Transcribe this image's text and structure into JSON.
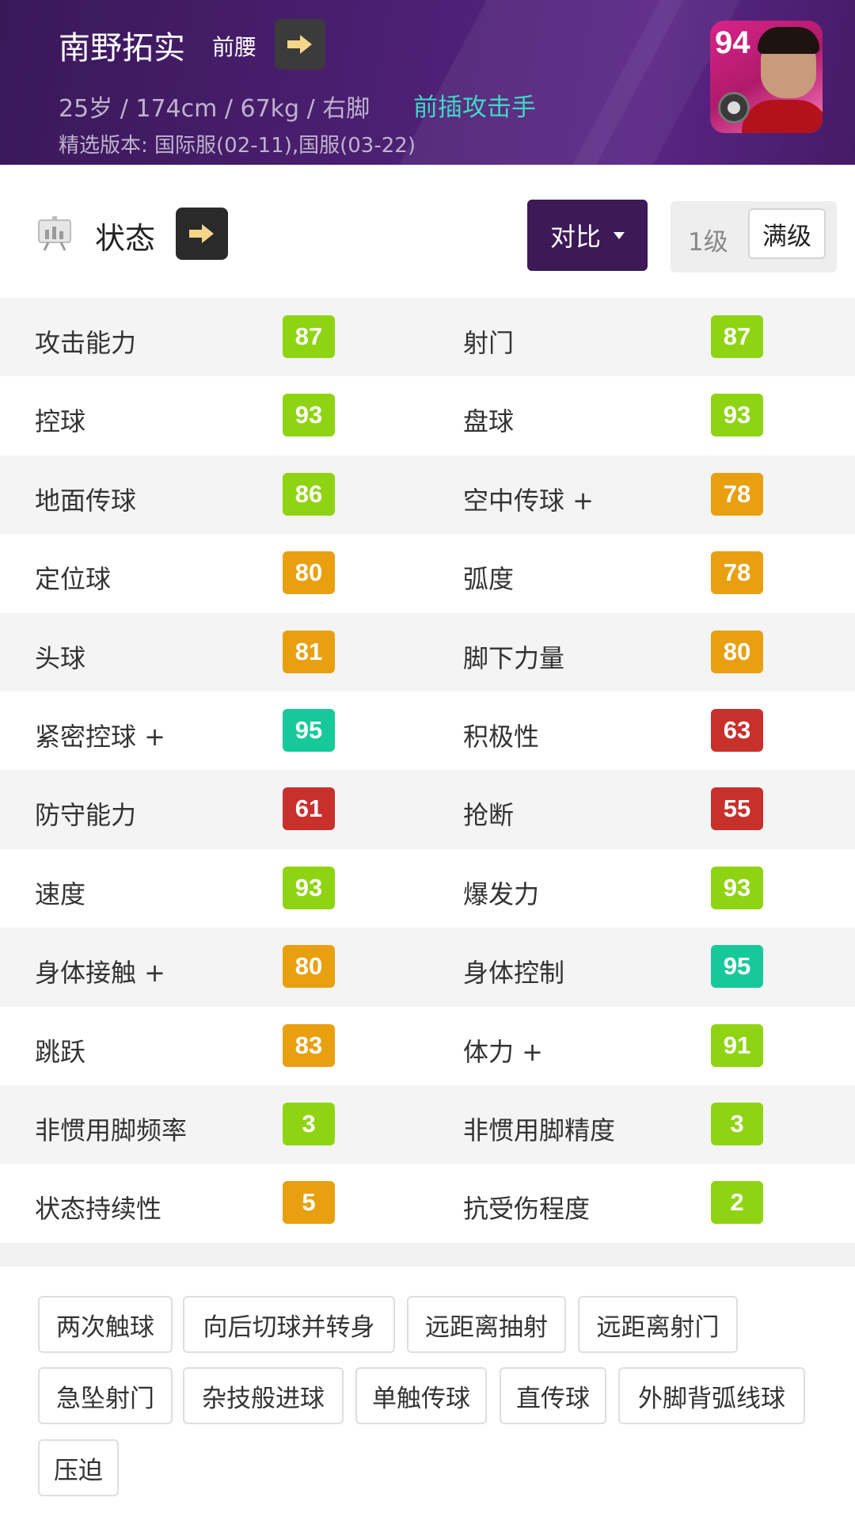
{
  "header": {
    "player_name": "南野拓实",
    "position": "前腰",
    "info": "25岁 / 174cm / 67kg / 右脚",
    "role": "前插攻击手",
    "version": "精选版本: 国际服(02-11),国服(03-22)",
    "card_rating": "94",
    "colors": {
      "bg": "#4b1f72",
      "role": "#3fd7c6",
      "card": "#d7248a"
    }
  },
  "status_bar": {
    "title": "状态",
    "compare_label": "对比",
    "level_options": [
      "1级",
      "满级"
    ],
    "selected_level": "满级"
  },
  "stat_colors": {
    "green": "#8fd412",
    "teal": "#17c99a",
    "orange": "#e8a010",
    "red": "#c8302c"
  },
  "stats": [
    {
      "left": {
        "name": "攻击能力",
        "value": "87",
        "color": "green"
      },
      "right": {
        "name": "射门",
        "value": "87",
        "color": "green"
      }
    },
    {
      "left": {
        "name": "控球",
        "value": "93",
        "color": "green"
      },
      "right": {
        "name": "盘球",
        "value": "93",
        "color": "green"
      }
    },
    {
      "left": {
        "name": "地面传球",
        "value": "86",
        "color": "green"
      },
      "right": {
        "name": "空中传球 +",
        "value": "78",
        "color": "orange"
      }
    },
    {
      "left": {
        "name": "定位球",
        "value": "80",
        "color": "orange"
      },
      "right": {
        "name": "弧度",
        "value": "78",
        "color": "orange"
      }
    },
    {
      "left": {
        "name": "头球",
        "value": "81",
        "color": "orange"
      },
      "right": {
        "name": "脚下力量",
        "value": "80",
        "color": "orange"
      }
    },
    {
      "left": {
        "name": "紧密控球 +",
        "value": "95",
        "color": "teal"
      },
      "right": {
        "name": "积极性",
        "value": "63",
        "color": "red"
      }
    },
    {
      "left": {
        "name": "防守能力",
        "value": "61",
        "color": "red"
      },
      "right": {
        "name": "抢断",
        "value": "55",
        "color": "red"
      }
    },
    {
      "left": {
        "name": "速度",
        "value": "93",
        "color": "green"
      },
      "right": {
        "name": "爆发力",
        "value": "93",
        "color": "green"
      }
    },
    {
      "left": {
        "name": "身体接触 +",
        "value": "80",
        "color": "orange"
      },
      "right": {
        "name": "身体控制",
        "value": "95",
        "color": "teal"
      }
    },
    {
      "left": {
        "name": "跳跃",
        "value": "83",
        "color": "orange"
      },
      "right": {
        "name": "体力 +",
        "value": "91",
        "color": "green"
      }
    },
    {
      "left": {
        "name": "非惯用脚频率",
        "value": "3",
        "color": "green"
      },
      "right": {
        "name": "非惯用脚精度",
        "value": "3",
        "color": "green"
      }
    },
    {
      "left": {
        "name": "状态持续性",
        "value": "5",
        "color": "orange"
      },
      "right": {
        "name": "抗受伤程度",
        "value": "2",
        "color": "green"
      }
    }
  ],
  "skills": [
    "两次触球",
    "向后切球并转身",
    "远距离抽射",
    "远距离射门",
    "急坠射门",
    "杂技般进球",
    "单触传球",
    "直传球",
    "外脚背弧线球",
    "压迫"
  ]
}
